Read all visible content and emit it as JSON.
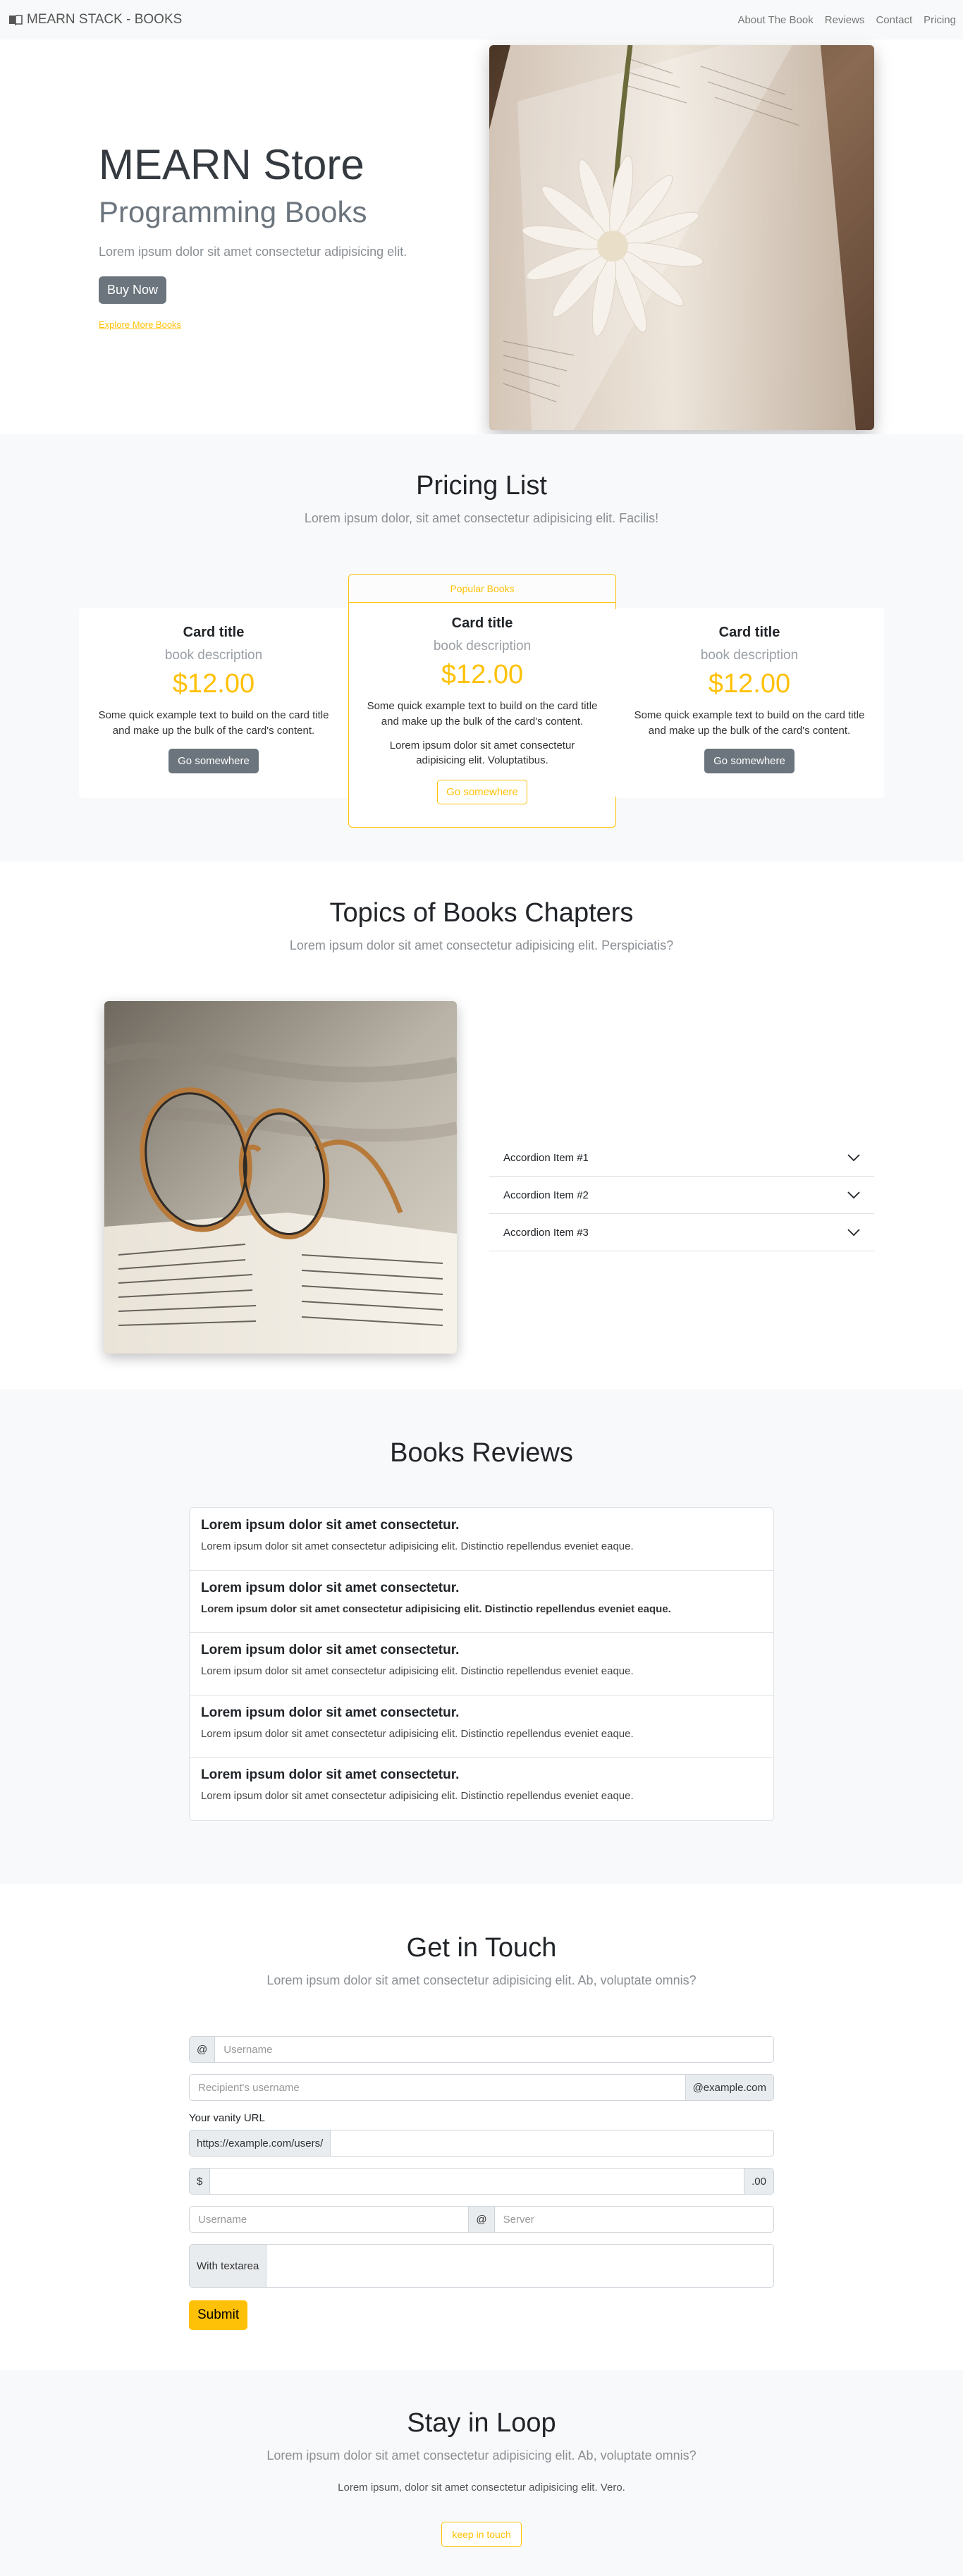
{
  "nav": {
    "brand": "MEARN STACK - BOOKS",
    "links": [
      "About The Book",
      "Reviews",
      "Contact",
      "Pricing"
    ]
  },
  "hero": {
    "title": "MEARN Store",
    "subtitle": "Programming Books",
    "lead": "Lorem ipsum dolor sit amet consectetur adipisicing elit.",
    "button": "Buy Now",
    "link": "Explore More Books"
  },
  "pricing": {
    "title": "Pricing List",
    "lead": "Lorem ipsum dolor, sit amet consectetur adipisicing elit. Facilis!",
    "cards": [
      {
        "title": "Card title",
        "desc": "book description",
        "price": "$12.00",
        "text": "Some quick example text to build on the card title and make up the bulk of the card's content.",
        "button": "Go somewhere"
      },
      {
        "header": "Popular Books",
        "title": "Card title",
        "desc": "book description",
        "price": "$12.00",
        "text": "Some quick example text to build on the card title and make up the bulk of the card's content.",
        "text2": "Lorem ipsum dolor sit amet consectetur adipisicing elit. Voluptatibus.",
        "button": "Go somewhere"
      },
      {
        "title": "Card title",
        "desc": "book description",
        "price": "$12.00",
        "text": "Some quick example text to build on the card title and make up the bulk of the card's content.",
        "button": "Go somewhere"
      }
    ]
  },
  "topics": {
    "title": "Topics of Books Chapters",
    "lead": "Lorem ipsum dolor sit amet consectetur adipisicing elit. Perspiciatis?",
    "accordion": [
      "Accordion Item #1",
      "Accordion Item #2",
      "Accordion Item #3"
    ]
  },
  "reviews": {
    "title": "Books Reviews",
    "items": [
      {
        "title": "Lorem ipsum dolor sit amet consectetur.",
        "text": "Lorem ipsum dolor sit amet consectetur adipisicing elit. Distinctio repellendus eveniet eaque."
      },
      {
        "title": "Lorem ipsum dolor sit amet consectetur.",
        "text": "Lorem ipsum dolor sit amet consectetur adipisicing elit. Distinctio repellendus eveniet eaque."
      },
      {
        "title": "Lorem ipsum dolor sit amet consectetur.",
        "text": "Lorem ipsum dolor sit amet consectetur adipisicing elit. Distinctio repellendus eveniet eaque."
      },
      {
        "title": "Lorem ipsum dolor sit amet consectetur.",
        "text": "Lorem ipsum dolor sit amet consectetur adipisicing elit. Distinctio repellendus eveniet eaque."
      },
      {
        "title": "Lorem ipsum dolor sit amet consectetur.",
        "text": "Lorem ipsum dolor sit amet consectetur adipisicing elit. Distinctio repellendus eveniet eaque."
      }
    ]
  },
  "contact": {
    "title": "Get in Touch",
    "lead": "Lorem ipsum dolor sit amet consectetur adipisicing elit. Ab, voluptate omnis?",
    "at": "@",
    "username_placeholder": "Username",
    "recipient_placeholder": "Recipient's username",
    "domain": "@example.com",
    "vanity_label": "Your vanity URL",
    "vanity_prefix": "https://example.com/users/",
    "dollar": "$",
    "cents": ".00",
    "username2_placeholder": "Username",
    "at2": "@",
    "server_placeholder": "Server",
    "textarea_label": "With textarea",
    "submit": "Submit"
  },
  "loop": {
    "title": "Stay in Loop",
    "lead": "Lorem ipsum dolor sit amet consectetur adipisicing elit. Ab, voluptate omnis?",
    "text": "Lorem ipsum, dolor sit amet consectetur adipisicing elit. Vero.",
    "button": "keep in touch"
  },
  "colors": {
    "accent": "#ffc107",
    "secondary": "#6c757d",
    "light_bg": "#f8f9fa"
  },
  "icons": {
    "brand": "book-icon",
    "accordion": "chevron-down-icon"
  }
}
